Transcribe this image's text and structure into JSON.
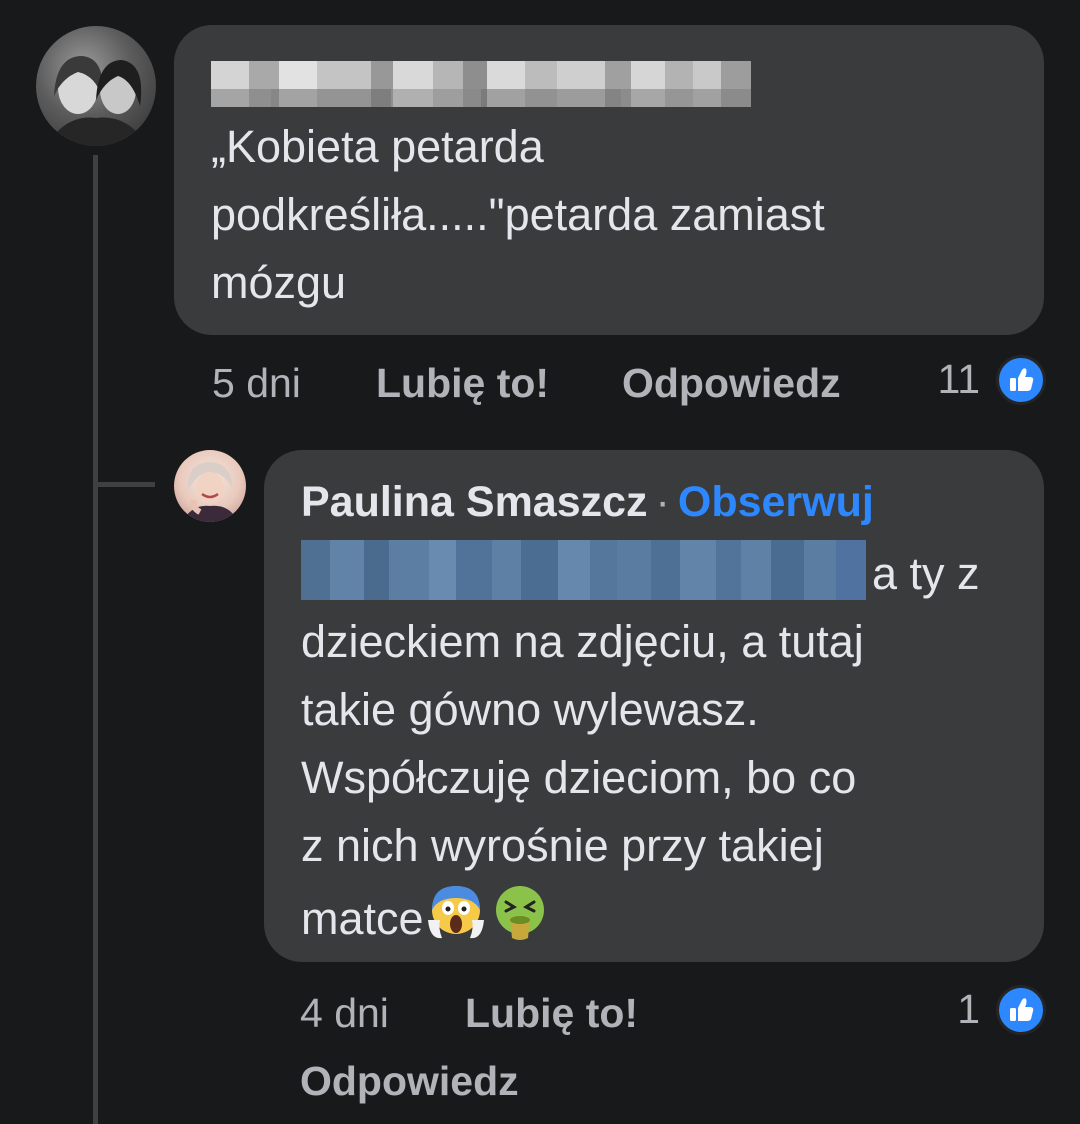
{
  "comment1": {
    "author_name": "",
    "text_lines": [
      "„Kobieta petarda",
      "podkreśliła.....\"petarda zamiast",
      "mózgu"
    ],
    "time": "5 dni",
    "like_label": "Lubię to!",
    "reply_label": "Odpowiedz",
    "like_count": "11"
  },
  "reply1": {
    "author_name": "Paulina Smaszcz",
    "separator": "·",
    "follow_label": "Obserwuj",
    "text_first_line_tail": "a ty z",
    "text_lines": [
      "dzieckiem na zdjęciu, a tutaj",
      "takie gówno wylewasz.",
      "Współczuję dzieciom, bo co",
      "z nich wyrośnie przy takiej"
    ],
    "text_last_line": "matce",
    "emojis": [
      "face-screaming-in-fear-emoji",
      "face-vomiting-emoji"
    ],
    "time": "4 dni",
    "like_label": "Lubię to!",
    "reply_label": "Odpowiedz",
    "like_count": "1"
  },
  "colors": {
    "background": "#18191a",
    "bubble": "#3a3b3c",
    "text": "#e4e6eb",
    "meta": "#b0b3b8",
    "accent": "#2d88ff"
  }
}
